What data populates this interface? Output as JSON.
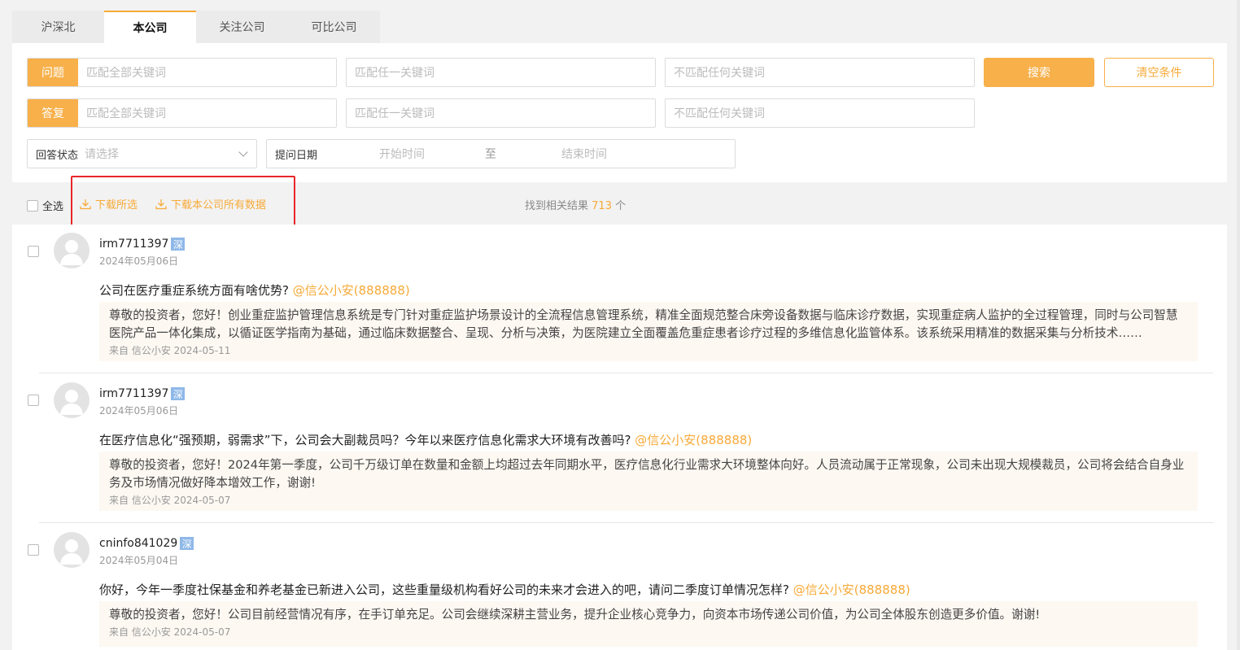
{
  "tabs": [
    {
      "label": "沪深北",
      "active": false
    },
    {
      "label": "本公司",
      "active": true
    },
    {
      "label": "关注公司",
      "active": false
    },
    {
      "label": "可比公司",
      "active": false
    }
  ],
  "filters": {
    "question_label": "问题",
    "answer_label": "答复",
    "match_all_placeholder": "匹配全部关键词",
    "match_any_placeholder": "匹配任一关键词",
    "match_none_placeholder": "不匹配任何关键词",
    "search_label": "搜索",
    "clear_label": "清空条件",
    "status_label": "回答状态",
    "status_placeholder": "请选择",
    "date_label": "提问日期",
    "start_placeholder": "开始时间",
    "range_sep": "至",
    "end_placeholder": "结束时间"
  },
  "toolbar": {
    "select_all": "全选",
    "download_selected": "下载所选",
    "download_all": "下载本公司所有数据",
    "result_prefix": "找到相关结果",
    "result_count": "713",
    "result_suffix": "个"
  },
  "items": [
    {
      "user": "irm7711397",
      "tag": "深",
      "date": "2024年05月06日",
      "question": "公司在医疗重症系统方面有啥优势?",
      "at": "@信公小安(888888)",
      "answer": "尊敬的投资者，您好！创业重症监护管理信息系统是专门针对重症监护场景设计的全流程信息管理系统，精准全面规范整合床旁设备数据与临床诊疗数据，实现重症病人监护的全过程管理，同时与公司智慧医院产品一体化集成，以循证医学指南为基础，通过临床数据整合、呈现、分析与决策，为医院建立全面覆盖危重症患者诊疗过程的多维信息化监管体系。该系统采用精准的数据采集与分析技术……",
      "source": "来自 信公小安 2024-05-11"
    },
    {
      "user": "irm7711397",
      "tag": "深",
      "date": "2024年05月06日",
      "question": "在医疗信息化“强预期，弱需求”下，公司会大副裁员吗？今年以来医疗信息化需求大环境有改善吗?",
      "at": "@信公小安(888888)",
      "answer": "尊敬的投资者，您好！2024年第一季度，公司千万级订单在数量和金额上均超过去年同期水平，医疗信息化行业需求大环境整体向好。人员流动属于正常现象，公司未出现大规模裁员，公司将会结合自身业务及市场情况做好降本增效工作，谢谢!",
      "source": "来自 信公小安 2024-05-07"
    },
    {
      "user": "cninfo841029",
      "tag": "深",
      "date": "2024年05月04日",
      "question": "你好，今年一季度社保基金和养老基金已新进入公司，这些重量级机构看好公司的未来才会进入的吧，请问二季度订单情况怎样?",
      "at": "@信公小安(888888)",
      "answer": "尊敬的投资者，您好！公司目前经营情况有序，在手订单充足。公司会继续深耕主营业务，提升企业核心竞争力，向资本市场传递公司价值，为公司全体股东创造更多价值。谢谢!",
      "source": "来自 信公小安 2024-05-07"
    }
  ]
}
